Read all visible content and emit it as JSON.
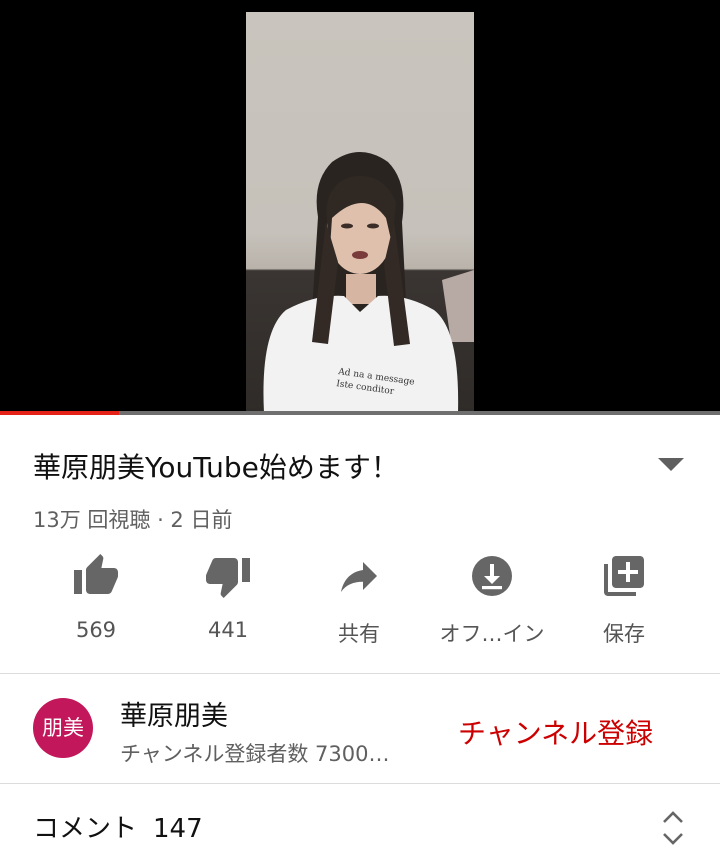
{
  "video": {
    "title": "華原朋美YouTube始めます！",
    "meta": "13万 回視聴 · 2 日前",
    "progress": 0.165,
    "shirt_text_1": "Ad na a message",
    "shirt_text_2": "Iste conditor"
  },
  "actions": [
    {
      "icon": "thumbs-up-icon",
      "label": "569"
    },
    {
      "icon": "thumbs-down-icon",
      "label": "441"
    },
    {
      "icon": "share-icon",
      "label": "共有"
    },
    {
      "icon": "download-icon",
      "label": "オフ…イン"
    },
    {
      "icon": "add-to-playlist-icon",
      "label": "保存"
    }
  ],
  "channel": {
    "avatar_text": "朋美",
    "avatar_color": "#c2185b",
    "name": "華原朋美",
    "subscribers": "チャンネル登録者数 7300…",
    "subscribe_label": "チャンネル登録"
  },
  "comments": {
    "label": "コメント",
    "count": "147"
  },
  "colors": {
    "accent": "#cc0000",
    "progress": "#e62117"
  }
}
